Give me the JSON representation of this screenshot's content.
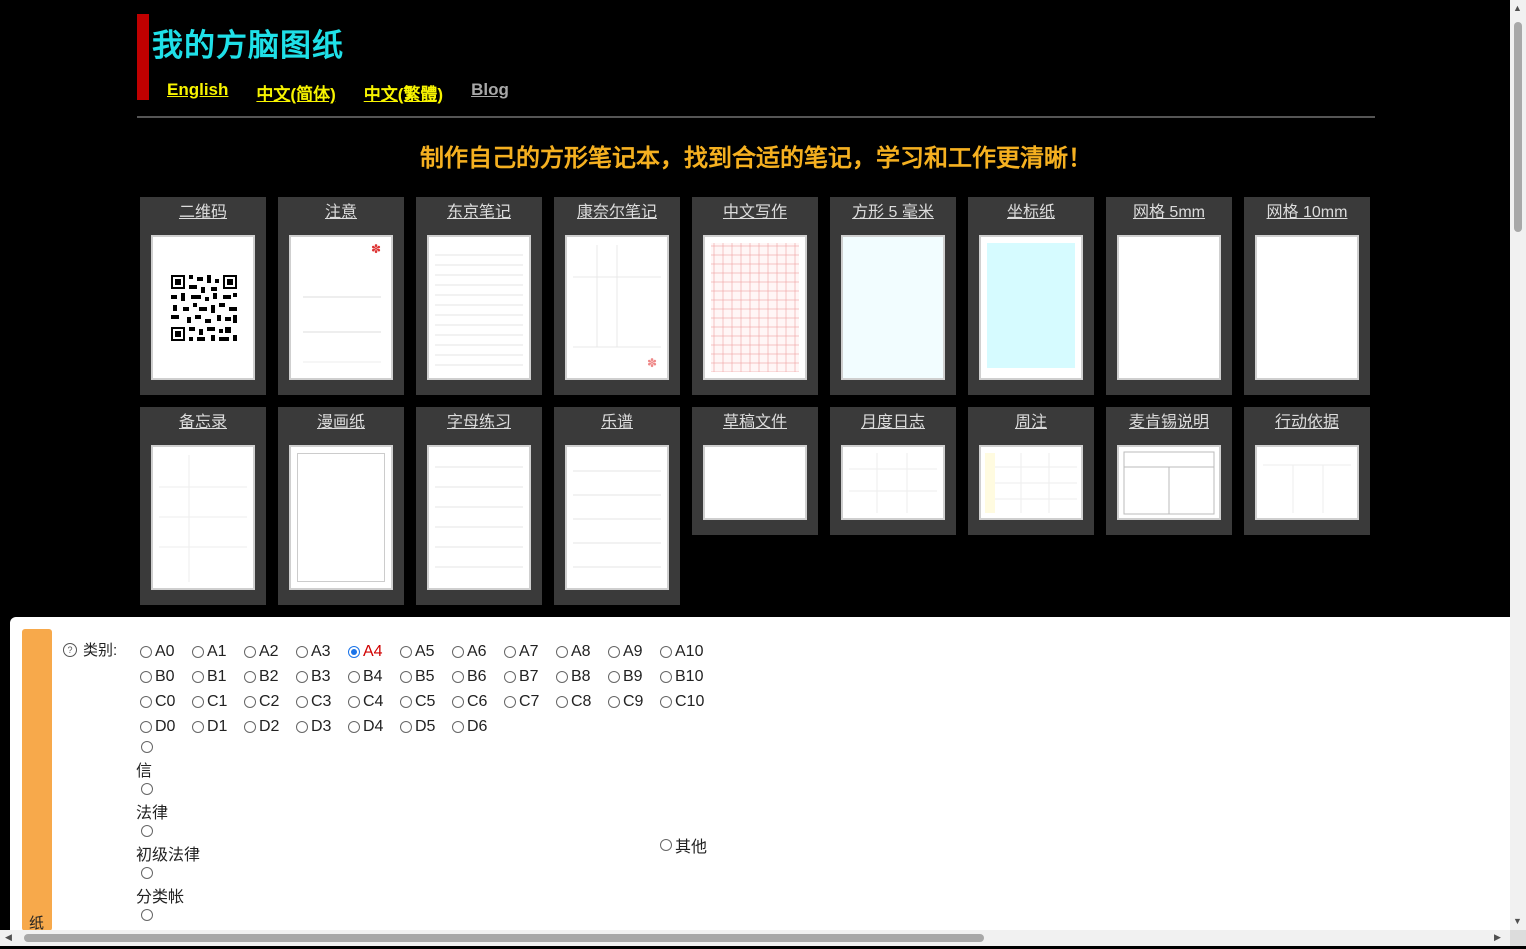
{
  "site": {
    "title": "我的方脑图纸",
    "languages": [
      "English",
      "中文(简体)",
      "中文(繁體)",
      "Blog"
    ],
    "slogan": "制作自己的方形笔记本，找到合适的笔记，学习和工作更清晰！"
  },
  "templates_row1": [
    "二维码",
    "注意",
    "东京笔记",
    "康奈尔笔记",
    "中文写作",
    "方形 5 毫米",
    "坐标纸",
    "网格 5mm",
    "网格 10mm"
  ],
  "templates_row2": [
    "备忘录",
    "漫画纸",
    "字母练习",
    "乐谱",
    "草稿文件",
    "月度日志",
    "周注",
    "麦肯锡说明",
    "行动依据"
  ],
  "form": {
    "section_label": "纸",
    "category_label": "类别:",
    "selected": "A4",
    "sizes": [
      [
        "A0",
        "A1",
        "A2",
        "A3",
        "A4",
        "A5",
        "A6",
        "A7",
        "A8",
        "A9",
        "A10"
      ],
      [
        "B0",
        "B1",
        "B2",
        "B3",
        "B4",
        "B5",
        "B6",
        "B7",
        "B8",
        "B9",
        "B10"
      ],
      [
        "C0",
        "C1",
        "C2",
        "C3",
        "C4",
        "C5",
        "C6",
        "C7",
        "C8",
        "C9",
        "C10"
      ],
      [
        "D0",
        "D1",
        "D2",
        "D3",
        "D4",
        "D5",
        "D6"
      ]
    ],
    "special": [
      "信",
      "法律",
      "初级法律",
      "分类帐",
      ""
    ],
    "other": "其他"
  }
}
